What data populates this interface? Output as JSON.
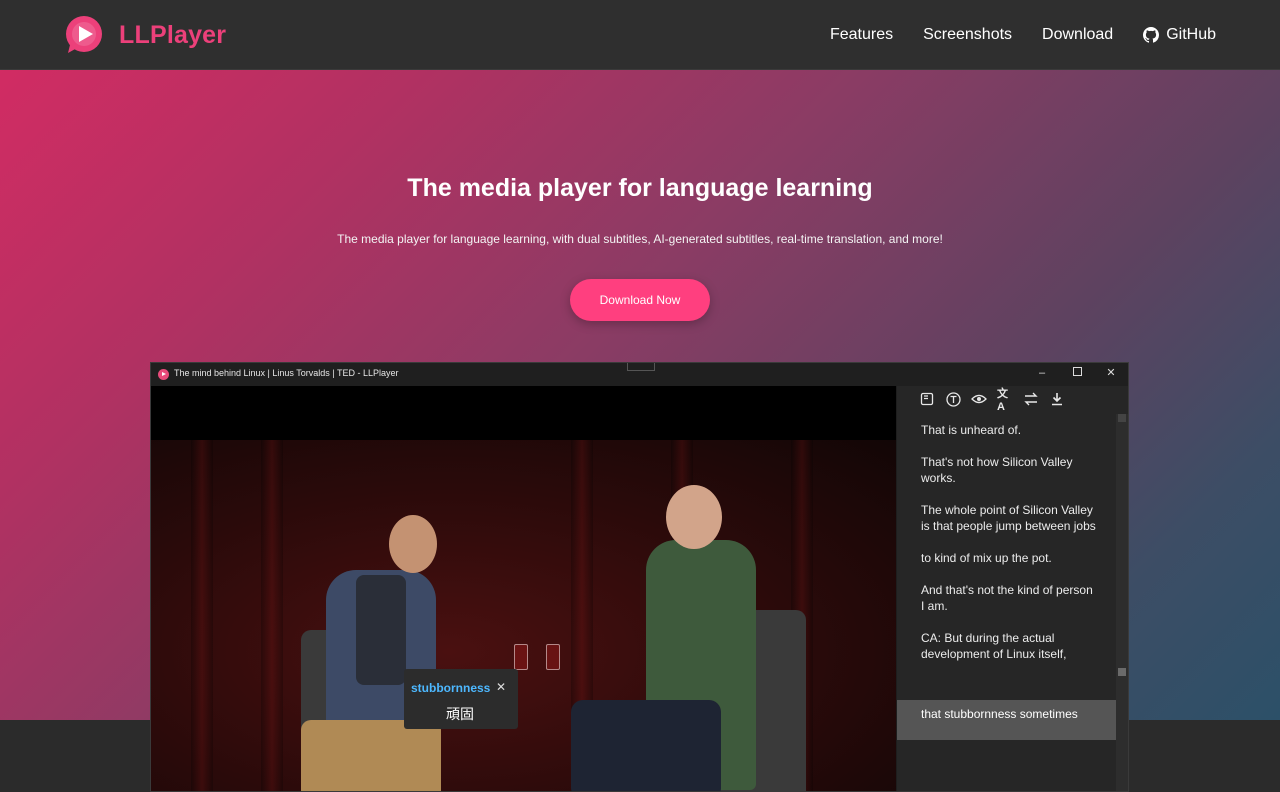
{
  "brand": {
    "name": "LLPlayer",
    "accent": "#ec407a"
  },
  "nav": {
    "links": [
      {
        "label": "Features"
      },
      {
        "label": "Screenshots"
      },
      {
        "label": "Download"
      },
      {
        "label": "GitHub",
        "icon": "github-icon"
      }
    ]
  },
  "hero": {
    "title": "The media player for language learning",
    "subtitle": "The media player for language learning, with dual subtitles, AI-generated subtitles, real-time translation, and more!",
    "cta_label": "Download Now",
    "cta_color": "#ff3f7f"
  },
  "window": {
    "title": "The mind behind Linux | Linus Torvalds | TED - LLPlayer",
    "controls": [
      "minimize-icon",
      "maximize-icon",
      "close-icon"
    ]
  },
  "popup": {
    "word": "stubbornness",
    "translation": "頑固"
  },
  "subtitles": {
    "toolbar_icons": [
      "book-icon",
      "text-icon",
      "eye-icon",
      "translate-icon",
      "swap-icon",
      "download-icon"
    ],
    "lines": [
      "That is unheard of.",
      "That's not how Silicon Valley works.",
      "The whole point of Silicon Valley\nis that people jump between jobs",
      "to kind of mix up the pot.",
      "And that's not the kind of person I am.",
      "CA: But during the actual development of Linux itself,"
    ],
    "selected_line": "that stubbornness sometimes"
  }
}
